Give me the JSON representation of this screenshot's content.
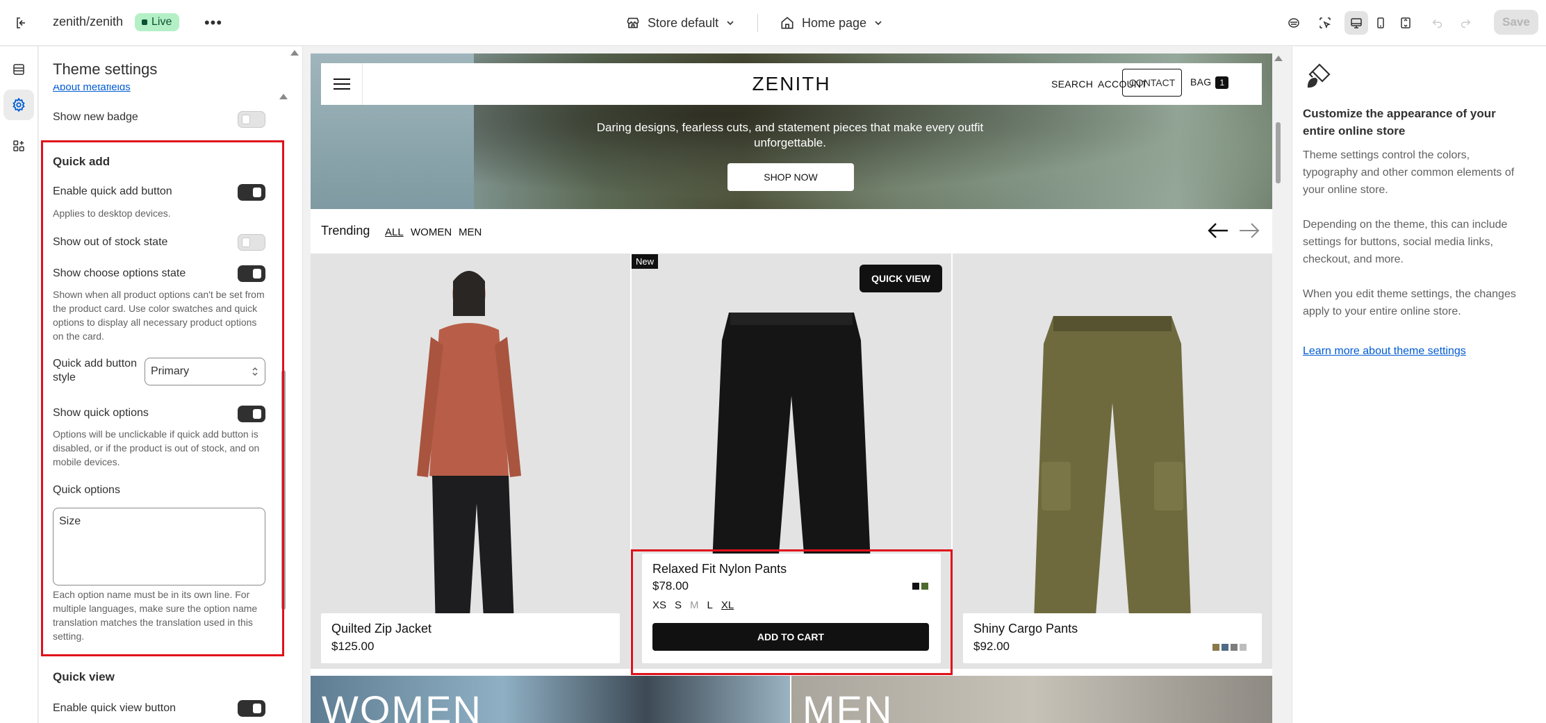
{
  "topbar": {
    "store_name": "zenith/zenith",
    "live_label": "Live",
    "more_label": "•••",
    "store_selector": "Store default",
    "page_selector": "Home page",
    "save_label": "Save"
  },
  "settings": {
    "title": "Theme settings",
    "about_link": "About metafields",
    "show_new_badge": "Show new badge",
    "quick_add": {
      "heading": "Quick add",
      "enable_label": "Enable quick add button",
      "enable_help": "Applies to desktop devices.",
      "out_of_stock_label": "Show out of stock state",
      "choose_options_label": "Show choose options state",
      "choose_options_help": "Shown when all product options can't be set from the product card. Use color swatches and quick options to display all necessary product options on the card.",
      "button_style_label": "Quick add button style",
      "button_style_value": "Primary",
      "show_quick_options_label": "Show quick options",
      "show_quick_options_help": "Options will be unclickable if quick add button is disabled, or if the product is out of stock, and on mobile devices.",
      "quick_options_label": "Quick options",
      "quick_options_value": "Size",
      "quick_options_help": "Each option name must be in its own line. For multiple languages, make sure the option name translation matches the translation used in this setting."
    },
    "quick_view": {
      "heading": "Quick view",
      "enable_label": "Enable quick view button"
    }
  },
  "preview": {
    "logo": "ZENITH",
    "nav": {
      "search": "SEARCH",
      "account": "ACCOUNT",
      "contact": "CONTACT",
      "bag": "BAG",
      "bag_count": "1"
    },
    "hero_text": "Daring designs, fearless cuts, and statement pieces that make every outfit unforgettable.",
    "hero_button": "SHOP NOW",
    "trending": "Trending",
    "filters": [
      "ALL",
      "WOMEN",
      "MEN"
    ],
    "new_badge": "New",
    "quick_view": "QUICK VIEW",
    "products": [
      {
        "name": "Quilted Zip Jacket",
        "price": "$125.00"
      },
      {
        "name": "Relaxed Fit Nylon Pants",
        "price": "$78.00",
        "sizes": [
          "XS",
          "S",
          "M",
          "L",
          "XL"
        ],
        "add_to_cart": "ADD TO CART"
      },
      {
        "name": "Shiny Cargo Pants",
        "price": "$92.00"
      }
    ],
    "banners": [
      "WOMEN",
      "MEN"
    ]
  },
  "info_panel": {
    "title": "Customize the appearance of your entire online store",
    "p1": "Theme settings control the colors, typography and other common elements of your online store.",
    "p2": "Depending on the theme, this can include settings for buttons, social media links, checkout, and more.",
    "p3": "When you edit theme settings, the changes apply to your entire online store.",
    "link": "Learn more about theme settings"
  },
  "colors": {
    "accent": "#303030",
    "link": "#005bd3",
    "highlight": "#e0101a",
    "live_bg": "#b4f0c6"
  }
}
